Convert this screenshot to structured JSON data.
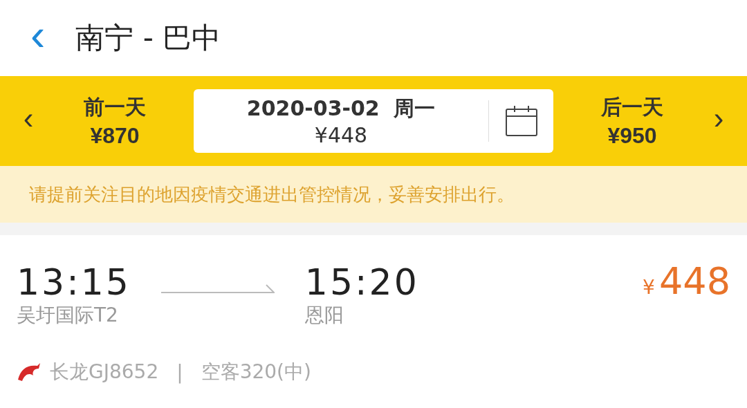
{
  "header": {
    "back_icon": "‹",
    "title": "南宁 - 巴中"
  },
  "date_bar": {
    "prev": {
      "arrow": "‹",
      "label": "前一天",
      "price": "¥870"
    },
    "current": {
      "date": "2020-03-02",
      "weekday": "周一",
      "price": "¥448"
    },
    "next": {
      "arrow": "›",
      "label": "后一天",
      "price": "¥950"
    }
  },
  "notice": "请提前关注目的地因疫情交通进出管控情况，妥善安排出行。",
  "flight": {
    "depart_time": "13:15",
    "depart_airport": "吴圩国际T2",
    "arrive_time": "15:20",
    "arrive_airport": "恩阳",
    "currency": "¥",
    "amount": "448",
    "airline": "长龙GJ8652",
    "separator": "|",
    "aircraft": "空客320(中)"
  }
}
